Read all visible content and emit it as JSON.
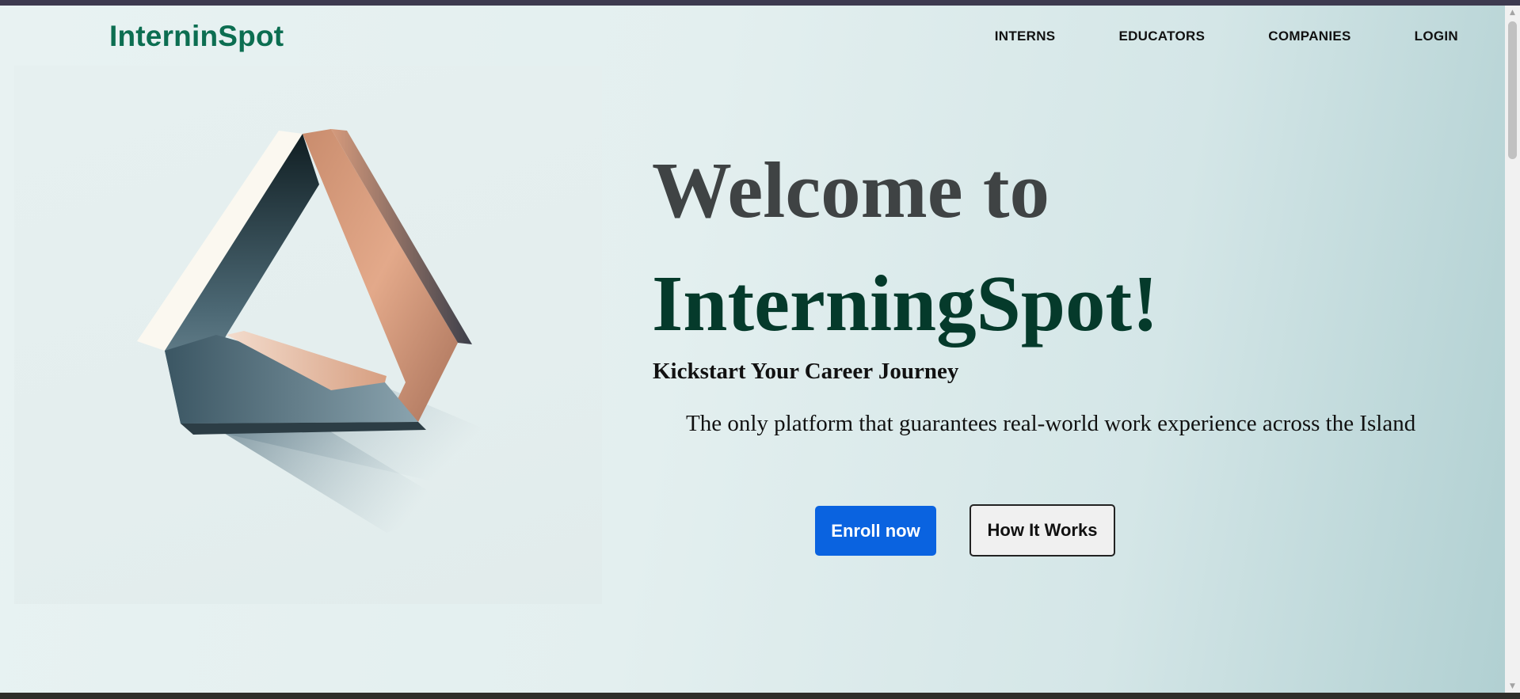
{
  "header": {
    "logo_text": "InterninSpot",
    "nav": [
      {
        "label": "INTERNS"
      },
      {
        "label": "EDUCATORS"
      },
      {
        "label": "COMPANIES"
      },
      {
        "label": "LOGIN"
      }
    ]
  },
  "hero": {
    "headline_line1": "Welcome to",
    "headline_line2": "InterningSpot!",
    "subheading": "Kickstart Your Career Journey",
    "tagline": "The only platform that guarantees real-world work experience across the Island",
    "primary_button": "Enroll now",
    "secondary_button": "How It Works",
    "illustration_icon": "impossible-triangle-icon"
  },
  "colors": {
    "logo": "#0c6e51",
    "headline_dark": "#3f4344",
    "headline_green": "#053a2b",
    "primary_button": "#0a63e0"
  }
}
